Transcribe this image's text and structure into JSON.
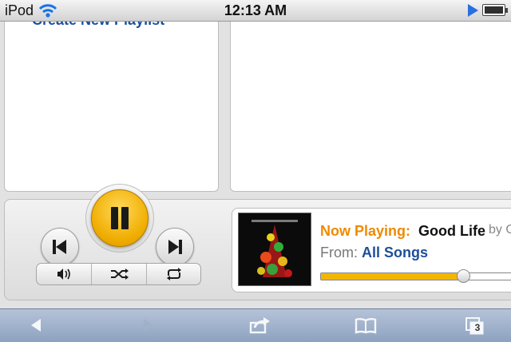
{
  "status_bar": {
    "carrier": "iPod",
    "time": "12:13 AM",
    "icons": [
      "wifi-icon",
      "play-indicator-icon",
      "battery-icon"
    ]
  },
  "left_pane": {
    "create_playlist_link": "Create New Playlist"
  },
  "player": {
    "controls": [
      "previous-track-icon",
      "pause-icon",
      "next-track-icon"
    ],
    "secondary_controls": [
      "volume-icon",
      "shuffle-icon",
      "repeat-icon"
    ],
    "now_playing_label": "Now Playing:",
    "track_title": "Good Life",
    "by_text": "by O",
    "from_label": "From:",
    "from_value": "All Songs",
    "progress": 0.69,
    "accent_color": "#f0ad00"
  },
  "toolbar": {
    "icons": [
      "back-icon",
      "forward-icon",
      "share-icon",
      "bookmarks-icon",
      "tabs-icon"
    ],
    "tab_count": "3"
  }
}
